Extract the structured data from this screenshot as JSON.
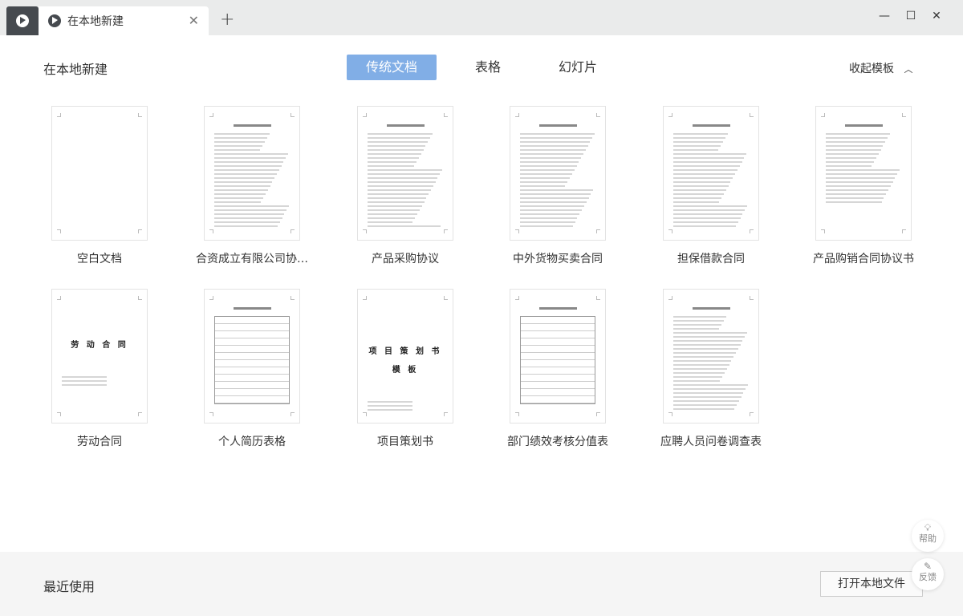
{
  "tab": {
    "title": "在本地新建"
  },
  "heading": "在本地新建",
  "categories": [
    {
      "label": "传统文档",
      "active": true
    },
    {
      "label": "表格"
    },
    {
      "label": "幻灯片"
    }
  ],
  "collapse_label": "收起模板",
  "templates": [
    {
      "label": "空白文档"
    },
    {
      "label": "合资成立有限公司协…"
    },
    {
      "label": "产品采购协议"
    },
    {
      "label": "中外货物买卖合同"
    },
    {
      "label": "担保借款合同"
    },
    {
      "label": "产品购销合同协议书"
    },
    {
      "label": "劳动合同",
      "thumb_title": "劳 动 合 同"
    },
    {
      "label": "个人简历表格"
    },
    {
      "label": "项目策划书",
      "thumb_title": "项 目 策 划 书",
      "thumb_sub": "模 板"
    },
    {
      "label": "部门绩效考核分值表"
    },
    {
      "label": "应聘人员问卷调查表"
    }
  ],
  "footer": {
    "recent": "最近使用",
    "open_local": "打开本地文件"
  },
  "help": {
    "help": "帮助",
    "feedback": "反馈"
  },
  "accent": "#81aee6"
}
